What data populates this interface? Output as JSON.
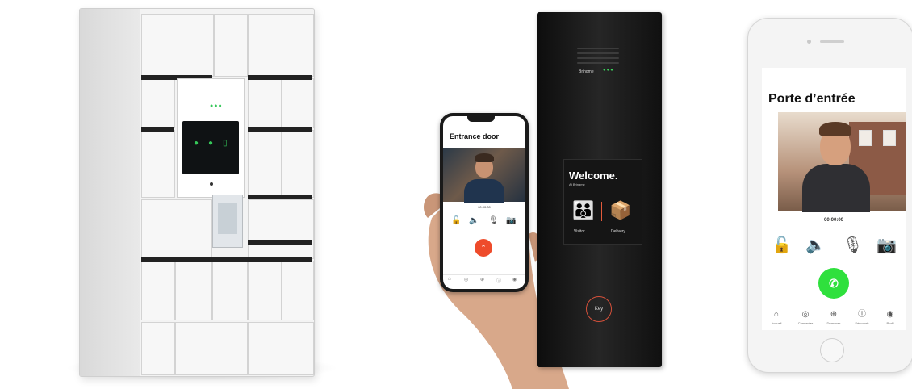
{
  "phone_hand": {
    "title": "Entrance door",
    "timer": "00:00:00",
    "controls": [
      "🔓",
      "🔈",
      "🎙",
      "📷"
    ],
    "end_call": "⌃",
    "nav": [
      "⌂",
      "◎",
      "⊕",
      "ⓘ",
      "◉"
    ]
  },
  "intercom": {
    "brand": "Bringme",
    "brand_dots": "●●●",
    "welcome": "Welcome.",
    "subtitle": "At Bringme",
    "visitor_label": "Visitor",
    "delivery_label": "Delivery",
    "key_label": "Key"
  },
  "phone_white": {
    "title": "Porte d’entrée",
    "timer": "00:00:00",
    "controls": [
      "🔓",
      "🔈",
      "🎙",
      "📷"
    ],
    "answer": "✆",
    "nav": [
      {
        "icon": "⌂",
        "label": "Accueil"
      },
      {
        "icon": "◎",
        "label": "Connecter"
      },
      {
        "icon": "⊕",
        "label": "Démarrer"
      },
      {
        "icon": "ⓘ",
        "label": "Découvrir"
      },
      {
        "icon": "◉",
        "label": "Profil"
      }
    ]
  },
  "locker": {
    "indicator_dots": "●●●"
  },
  "colors": {
    "accent_green": "#2fe03d",
    "accent_red": "#ee4b2b",
    "panel_black": "#151515"
  }
}
